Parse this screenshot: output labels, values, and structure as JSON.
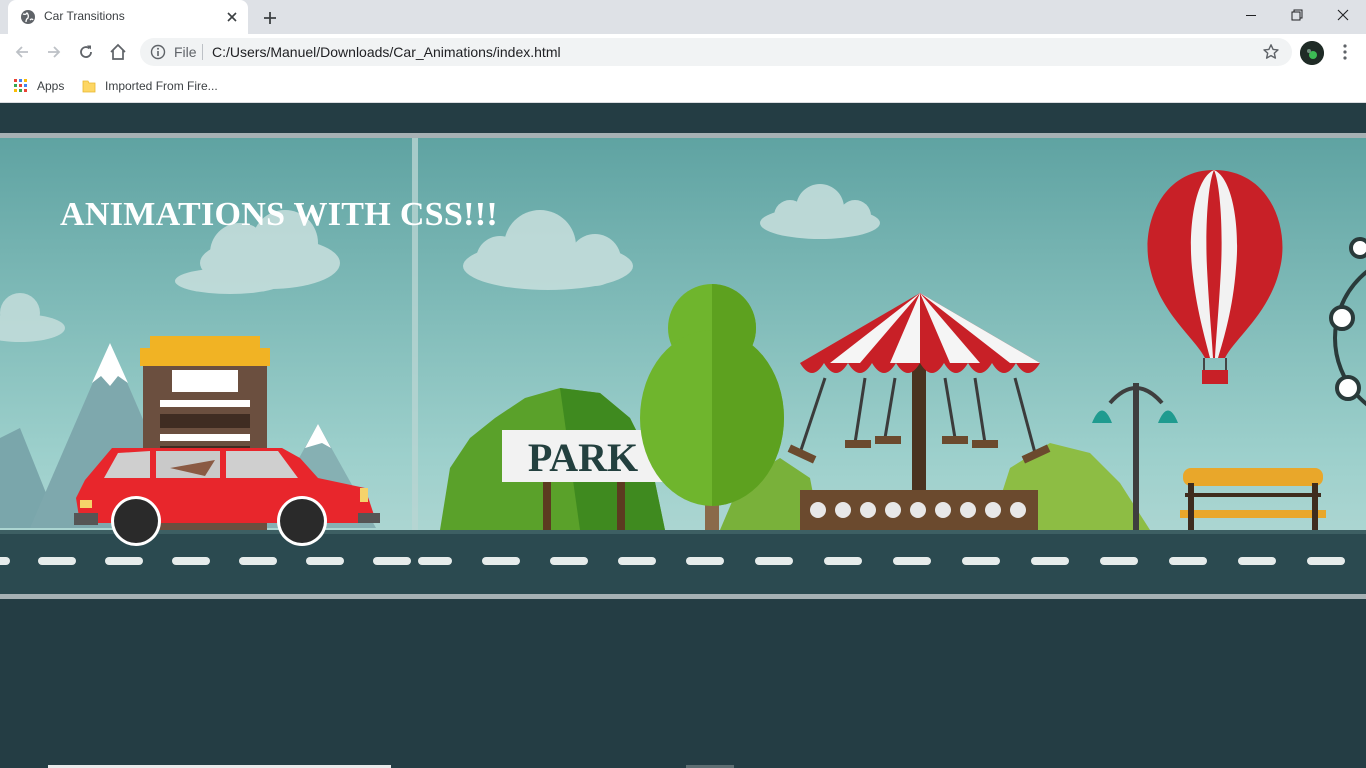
{
  "browser": {
    "tab": {
      "title": "Car Transitions"
    },
    "address": {
      "scheme_label": "File",
      "url": "C:/Users/Manuel/Downloads/Car_Animations/index.html"
    },
    "bookmarks": [
      {
        "label": "Apps",
        "icon": "apps-grid-icon"
      },
      {
        "label": "Imported From Fire...",
        "icon": "folder-icon"
      }
    ]
  },
  "page": {
    "heading": "ANIMATIONS WITH CSS!!!",
    "park_sign": "PARK"
  },
  "colors": {
    "page_background": "#243d44",
    "sky_top": "#5fa3a2",
    "sky_bottom": "#b8dad6",
    "road": "#2b4a50",
    "car_body": "#e8262c",
    "heading_text": "#ffffff"
  }
}
